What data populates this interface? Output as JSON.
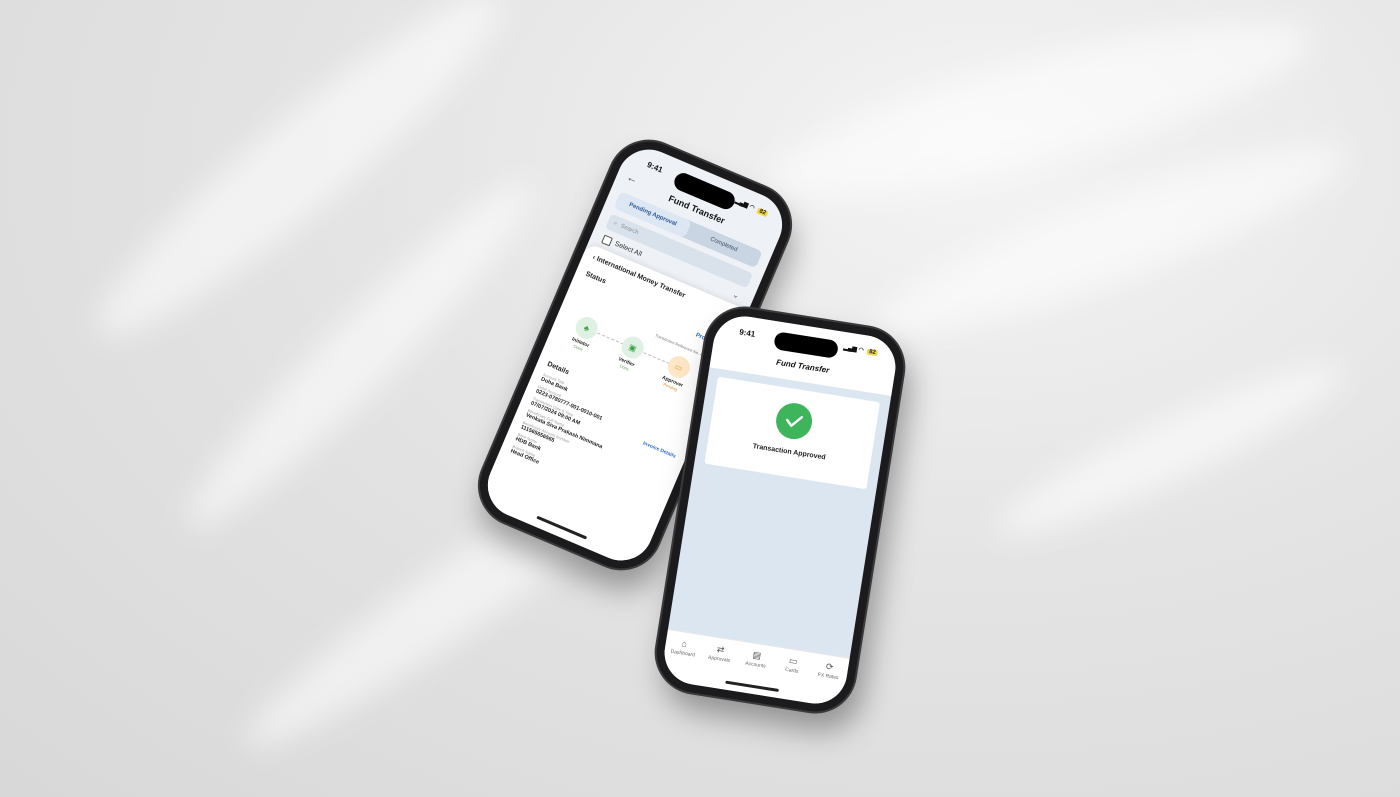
{
  "colors": {
    "accent": "#2c6bd3",
    "success": "#3fb55b",
    "pending": "#e39a2a",
    "screen_bg": "#dbe6f1"
  },
  "phone1": {
    "status": {
      "time": "9:41",
      "battery": "82"
    },
    "header": {
      "title": "Fund Transfer",
      "back_icon": "back-arrow-icon"
    },
    "tabs": [
      {
        "label": "Pending Approval",
        "active": true
      },
      {
        "label": "Completed",
        "active": false
      }
    ],
    "search": {
      "placeholder": "Search"
    },
    "select_all": "Select All",
    "sheet": {
      "title": "International Money Transfer",
      "status_label": "Status",
      "proceed": "Proceed >",
      "reference": "Transaction Reference No. 446580",
      "steps": [
        {
          "name": "Initiator",
          "sub": "Done"
        },
        {
          "name": "Verifier",
          "sub": "Done"
        },
        {
          "name": "Approver",
          "sub": "Pending"
        }
      ],
      "details_label": "Details",
      "invoice_link": "Invoice Details",
      "fields": [
        {
          "label": "Account Title",
          "value": "Doha Bank"
        },
        {
          "label": "Debit Account",
          "value": "0223-0780777-001-0010-001"
        },
        {
          "label": "Transaction Date & Time",
          "value": "07/07/2024 09:00 AM"
        },
        {
          "label": "Beneficiary Full Name",
          "value": "Venkata Siva Prakash Nimmana"
        },
        {
          "label": "Beneficiary Account Number",
          "value": "111565656565"
        },
        {
          "label": "Bank Name",
          "value": "HDB Bank"
        },
        {
          "label": "Branch Name",
          "value": "Head Office"
        }
      ]
    }
  },
  "phone2": {
    "status": {
      "time": "9:41",
      "battery": "82"
    },
    "title": "Fund Transfer",
    "message": "Transaction Approved",
    "nav": [
      {
        "label": "Dashboard",
        "icon": "home-icon"
      },
      {
        "label": "Approvals",
        "icon": "swap-arrows-icon"
      },
      {
        "label": "Accounts",
        "icon": "bank-icon"
      },
      {
        "label": "Cards",
        "icon": "card-icon"
      },
      {
        "label": "FX Rates",
        "icon": "refresh-icon"
      }
    ]
  }
}
